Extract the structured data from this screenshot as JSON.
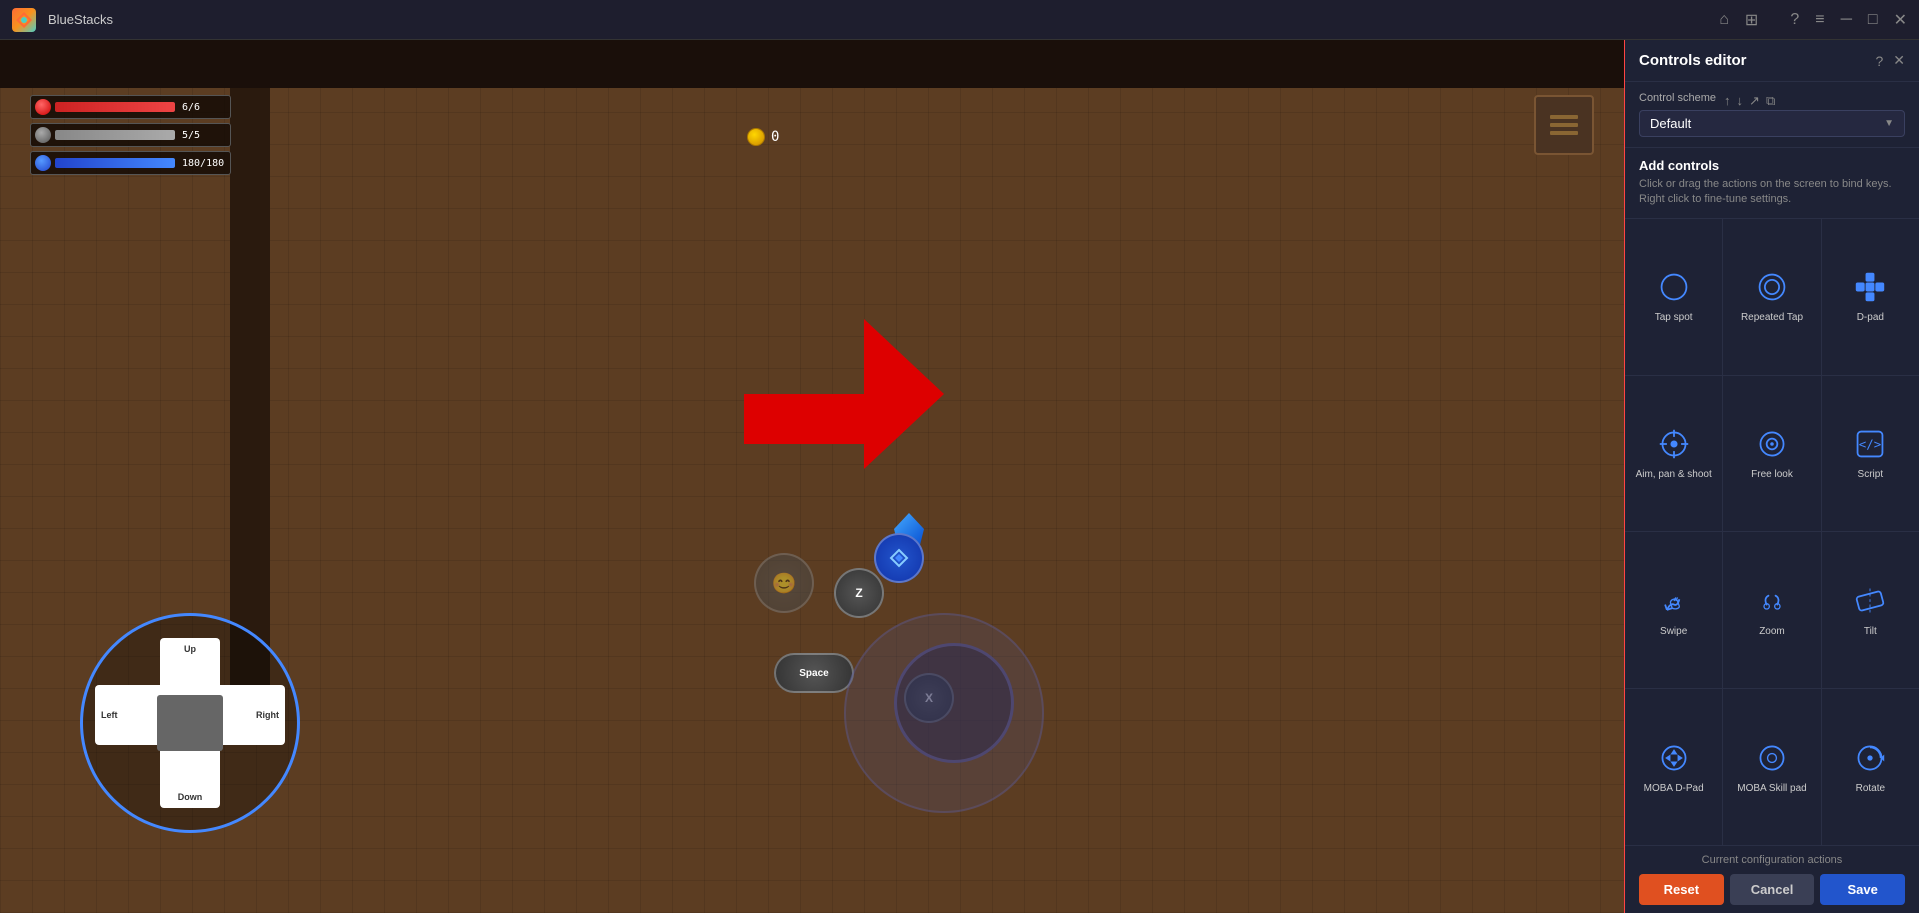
{
  "titleBar": {
    "appName": "BlueStacks",
    "homeIcon": "⌂",
    "gridIcon": "⊞",
    "helpIcon": "?",
    "menuIcon": "≡",
    "minimizeIcon": "─",
    "maximizeIcon": "□",
    "closeIcon": "✕"
  },
  "hud": {
    "health": "6/6",
    "shield": "5/5",
    "mana": "180/180",
    "coin": "0"
  },
  "dpad": {
    "up": "Up",
    "down": "Down",
    "left": "Left",
    "right": "Right"
  },
  "actionButtons": {
    "z": "Z",
    "x": "X",
    "space": "Space"
  },
  "controlsEditor": {
    "title": "Controls editor",
    "helpIcon": "?",
    "closeIcon": "✕",
    "controlSchemeLabel": "Control scheme",
    "selectedScheme": "Default",
    "addControlsTitle": "Add controls",
    "addControlsDesc": "Click or drag the actions on the screen to bind keys. Right click to fine-tune settings.",
    "controls": [
      {
        "id": "tap-spot",
        "label": "Tap spot",
        "icon": "tap"
      },
      {
        "id": "repeated-tap",
        "label": "Repeated Tap",
        "icon": "repeated-tap"
      },
      {
        "id": "d-pad",
        "label": "D-pad",
        "icon": "dpad"
      },
      {
        "id": "aim-pan-shoot",
        "label": "Aim, pan & shoot",
        "icon": "aim"
      },
      {
        "id": "free-look",
        "label": "Free look",
        "icon": "freelook"
      },
      {
        "id": "script",
        "label": "Script",
        "icon": "script"
      },
      {
        "id": "swipe",
        "label": "Swipe",
        "icon": "swipe"
      },
      {
        "id": "zoom",
        "label": "Zoom",
        "icon": "zoom"
      },
      {
        "id": "tilt",
        "label": "Tilt",
        "icon": "tilt"
      },
      {
        "id": "moba-dpad",
        "label": "MOBA D-Pad",
        "icon": "moba-dpad"
      },
      {
        "id": "moba-skill-pad",
        "label": "MOBA Skill pad",
        "icon": "moba-skill"
      },
      {
        "id": "rotate",
        "label": "Rotate",
        "icon": "rotate"
      }
    ],
    "currentConfigLabel": "Current configuration actions",
    "resetLabel": "Reset",
    "cancelLabel": "Cancel",
    "saveLabel": "Save"
  }
}
